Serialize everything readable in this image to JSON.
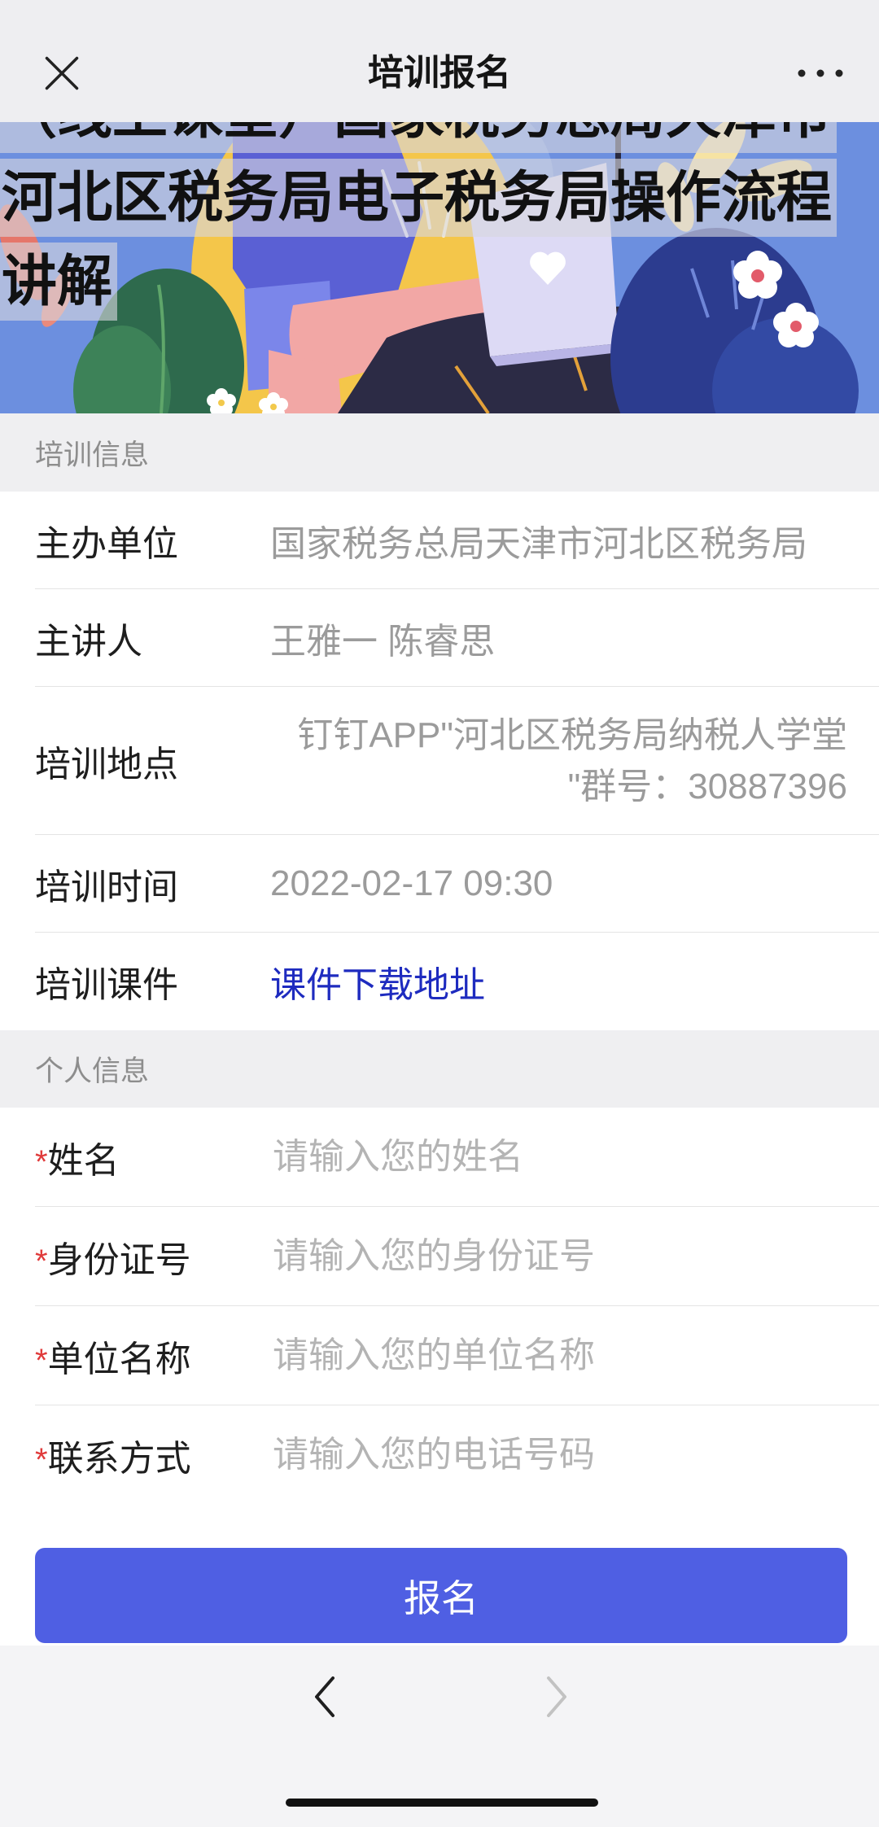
{
  "nav": {
    "title": "培训报名"
  },
  "icons": {
    "close": "close-icon",
    "more": "more-icon",
    "back": "chevron-left-icon",
    "forward": "chevron-right-icon",
    "banner_heart": "heart-icon"
  },
  "banner": {
    "title_lines": [
      "（线上课堂）国家税务总局天津市",
      "河北区税务局电子税务局操作流程",
      "讲解"
    ]
  },
  "training_info": {
    "section_title": "培训信息",
    "organizer": {
      "label": "主办单位",
      "value": "国家税务总局天津市河北区税务局"
    },
    "lecturer": {
      "label": "主讲人",
      "value": "王雅一 陈睿思"
    },
    "location": {
      "label": "培训地点",
      "value_lines": [
        "钉钉APP\"河北区税务局纳税人学堂",
        "\"群号：30887396"
      ]
    },
    "time": {
      "label": "培训时间",
      "value": "2022-02-17 09:30"
    },
    "materials": {
      "label": "培训课件",
      "link_text": "课件下载地址"
    }
  },
  "personal_info": {
    "section_title": "个人信息",
    "required_mark": "*",
    "fields": [
      {
        "label": "姓名",
        "placeholder": "请输入您的姓名"
      },
      {
        "label": "身份证号",
        "placeholder": "请输入您的身份证号"
      },
      {
        "label": "单位名称",
        "placeholder": "请输入您的单位名称"
      },
      {
        "label": "联系方式",
        "placeholder": "请输入您的电话号码"
      }
    ]
  },
  "submit": {
    "label": "报名"
  },
  "toolbar": {
    "back_enabled": true,
    "forward_enabled": false
  },
  "colors": {
    "accent": "#4f5fe3",
    "link": "#1e2bbf",
    "required": "#e03a3a",
    "banner_background": "#6c8fdf"
  }
}
